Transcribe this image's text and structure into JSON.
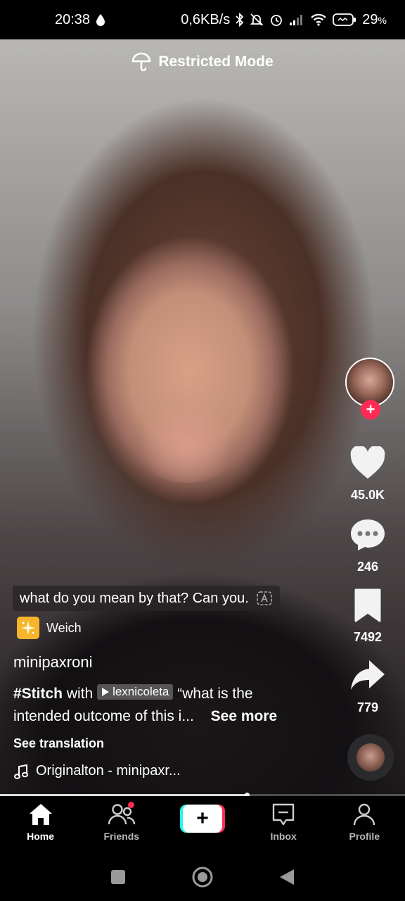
{
  "status_bar": {
    "time": "20:38",
    "speed": "0,6KB/s",
    "battery": "29",
    "battery_unit": "%"
  },
  "restricted_mode": {
    "label": "Restricted Mode"
  },
  "rail": {
    "likes": "45.0K",
    "comments": "246",
    "saves": "7492",
    "shares": "779",
    "follow_symbol": "+"
  },
  "caption": {
    "text": "what do you mean by that? Can you."
  },
  "effect": {
    "name": "Weich"
  },
  "post": {
    "username": "minipaxroni",
    "hashtag": "#Stitch",
    "with_word": "with",
    "mention": "lexnicoleta",
    "quote_line1": "“what is the",
    "quote_line2": "intended outcome of this i...",
    "see_more": "See more",
    "see_translation": "See translation",
    "sound": "Originalton - minipaxr..."
  },
  "playback": {
    "progress": 0.61
  },
  "nav": {
    "home": "Home",
    "friends": "Friends",
    "create": "+",
    "inbox": "Inbox",
    "profile": "Profile"
  },
  "colors": {
    "accent_pink": "#fe2c55",
    "accent_cyan": "#25f4ee",
    "effect_icon_bg": "#f7b52c"
  }
}
